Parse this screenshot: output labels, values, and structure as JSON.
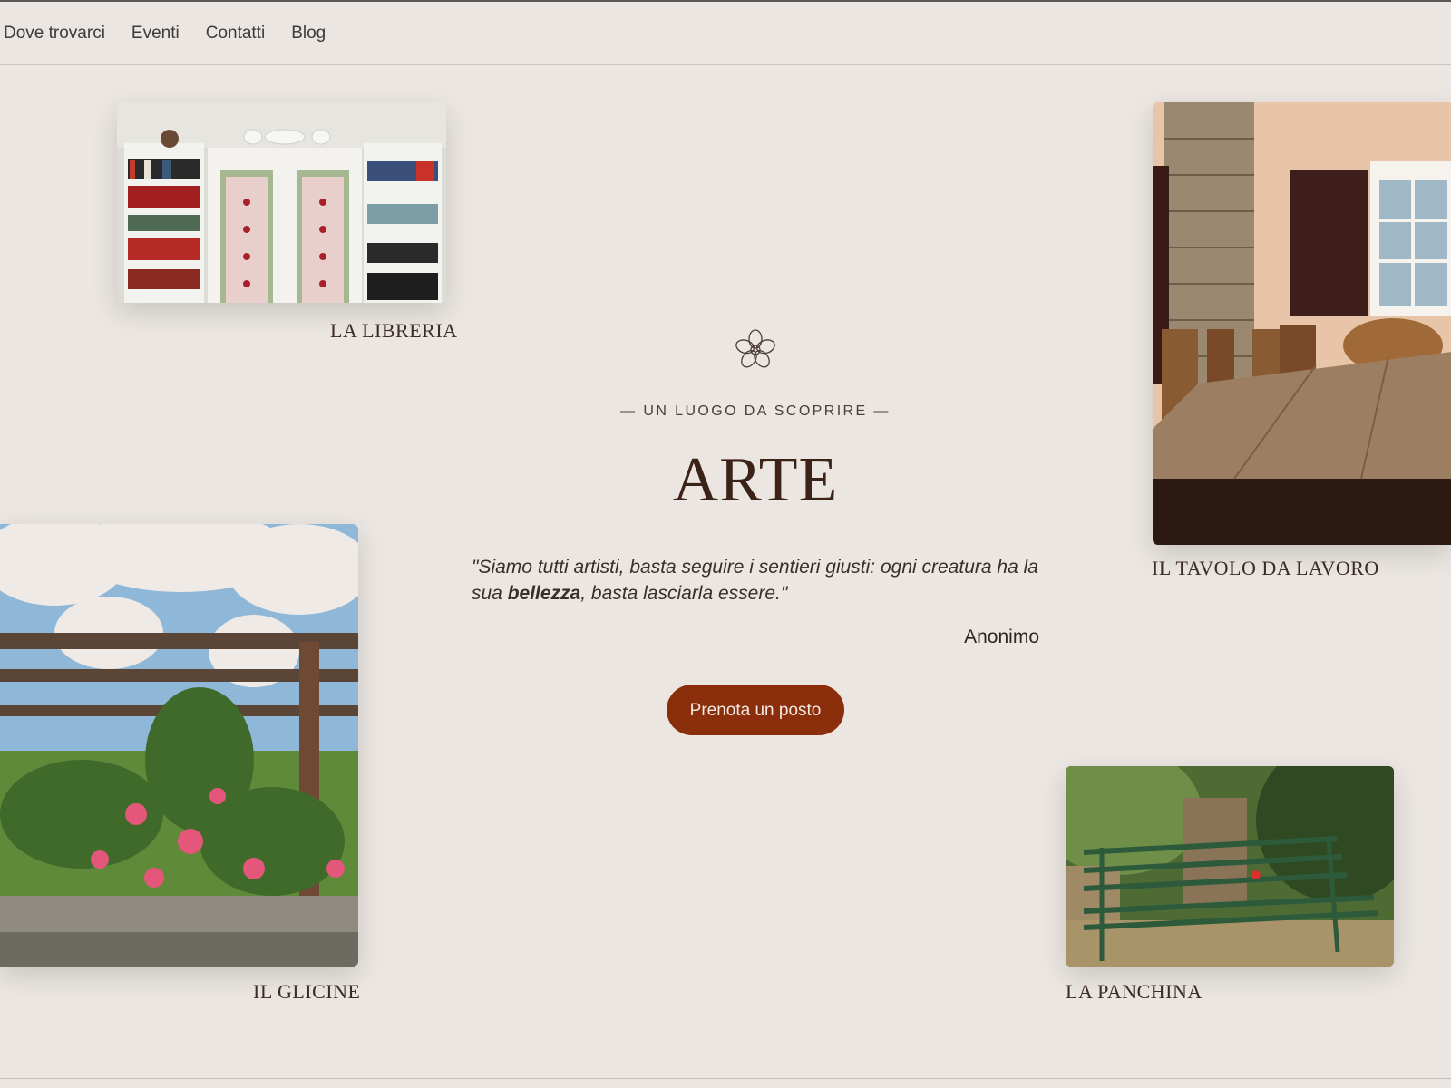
{
  "nav": {
    "items": [
      {
        "label": "Dove trovarci"
      },
      {
        "label": "Eventi"
      },
      {
        "label": "Contatti"
      },
      {
        "label": "Blog"
      }
    ]
  },
  "gallery": {
    "libreria": {
      "caption": "LA LIBRERIA"
    },
    "tavolo": {
      "caption": "IL TAVOLO DA LAVORO"
    },
    "glicine": {
      "caption": "IL GLICINE"
    },
    "panchina": {
      "caption": "LA PANCHINA"
    }
  },
  "hero": {
    "icon": "flower-icon",
    "eyebrow": "— UN LUOGO DA SCOPRIRE —",
    "title": "ARTE",
    "quote_before": "\"Siamo tutti artisti, basta seguire i sentieri giusti: ogni creatura ha la sua ",
    "quote_bold": "bellezza",
    "quote_after": ", basta lasciarla essere.\"",
    "author": "Anonimo",
    "cta_label": "Prenota un posto"
  },
  "colors": {
    "background": "#ebe6e1",
    "accent": "#8a2e0b",
    "text": "#3c2318"
  }
}
